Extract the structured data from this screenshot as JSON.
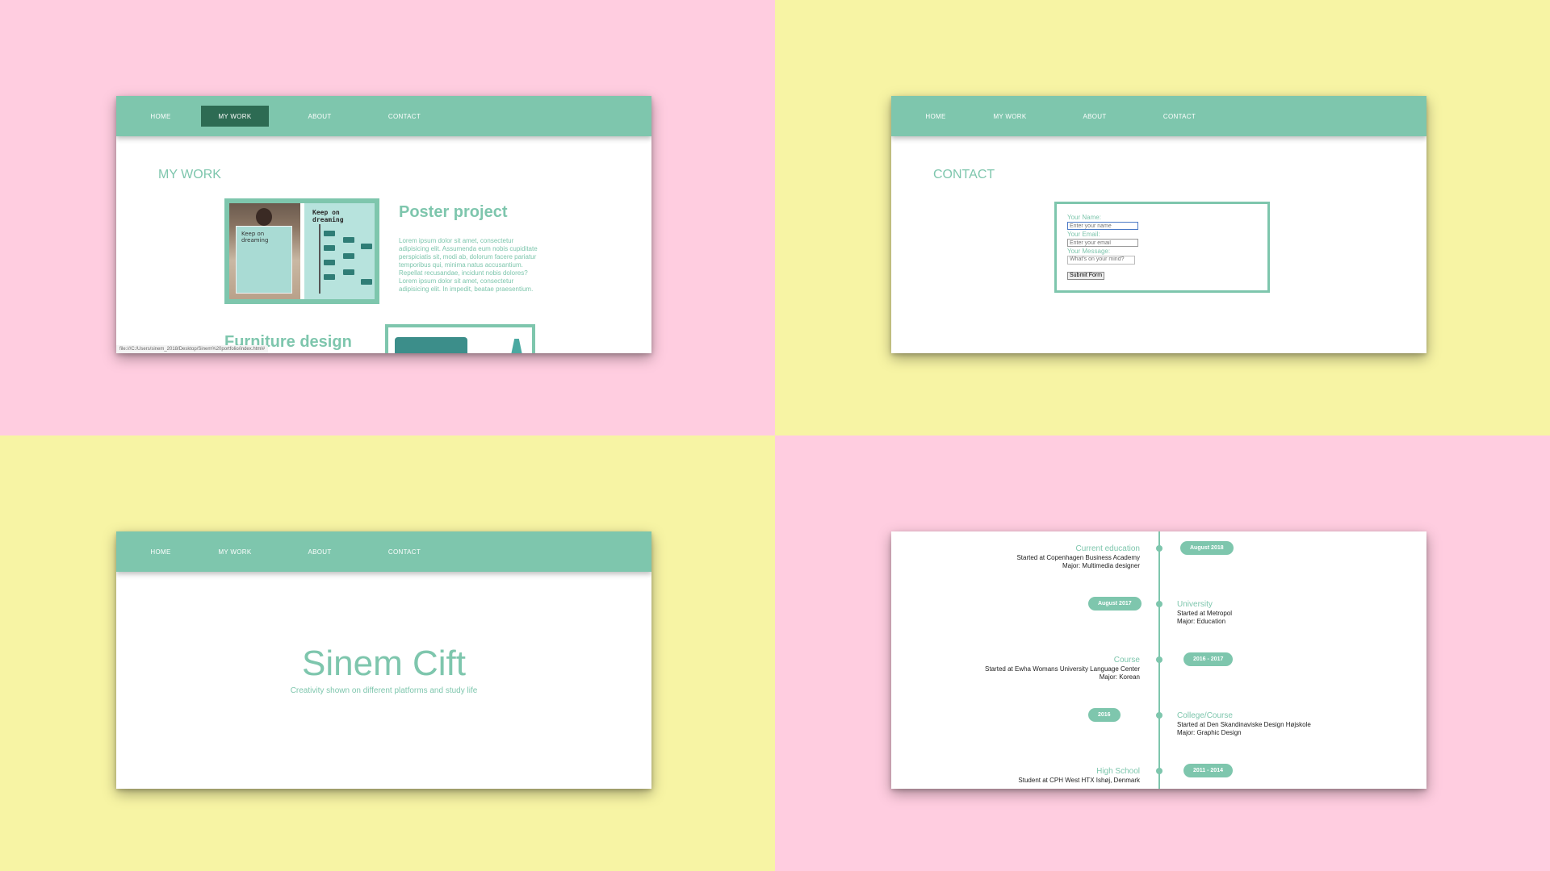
{
  "colors": {
    "teal": "#7ec6ad",
    "dark_teal": "#2d6b53",
    "pink_bg": "#ffcde0",
    "yellow_bg": "#f7f4a4"
  },
  "nav": {
    "home": "HOME",
    "my_work": "MY WORK",
    "about": "ABOUT",
    "contact": "CONTACT"
  },
  "my_work": {
    "title": "MY WORK",
    "poster_title": "Poster project",
    "poster_body": "Lorem ipsum dolor sit amet, consectetur adipisicing elit. Assumenda eum nobis cupiditate perspiciatis sit, modi ab, dolorum facere pariatur temporibus qui, minima natus accusantium. Repellat recusandae, incidunt nobis dolores? Lorem ipsum dolor sit amet, consectetur adipisicing elit. In impedit, beatae praesentium.",
    "poster_image_title": "Keep on dreaming",
    "poster_held_title": "Keep on dreaming",
    "furniture_title": "Furniture design",
    "status_url": "file:///C:/Users/sinem_2018/Desktop/Sinem%20portfolio/index.html#"
  },
  "contact": {
    "title": "CONTACT",
    "name_label": "Your Name:",
    "name_placeholder": "Enter your name",
    "email_label": "Your Email:",
    "email_placeholder": "Enter your email",
    "message_label": "Your Message:",
    "message_placeholder": "What's on your mind?",
    "submit_label": "Submit Form"
  },
  "home": {
    "name": "Sinem Cift",
    "tagline": "Creativity shown on different platforms and study life"
  },
  "timeline": {
    "entries": [
      {
        "side": "left",
        "heading": "Current education",
        "line1": "Started at Copenhagen Business Academy",
        "line2": "Major: Multimedia designer",
        "badge": "August 2018"
      },
      {
        "side": "right",
        "heading": "University",
        "line1": "Started at Metropol",
        "line2": "Major: Education",
        "badge": "August 2017"
      },
      {
        "side": "left",
        "heading": "Course",
        "line1": "Started at Ewha Womans University Language Center",
        "line2": "Major: Korean",
        "badge": "2016 - 2017"
      },
      {
        "side": "right",
        "heading": "College/Course",
        "line1": "Started at Den Skandinaviske Design Højskole",
        "line2": "Major: Graphic Design",
        "badge": "2016"
      },
      {
        "side": "left",
        "heading": "High School",
        "line1": "Student at CPH West HTX Ishøj, Denmark",
        "line2": "",
        "badge": "2011 - 2014"
      }
    ]
  }
}
